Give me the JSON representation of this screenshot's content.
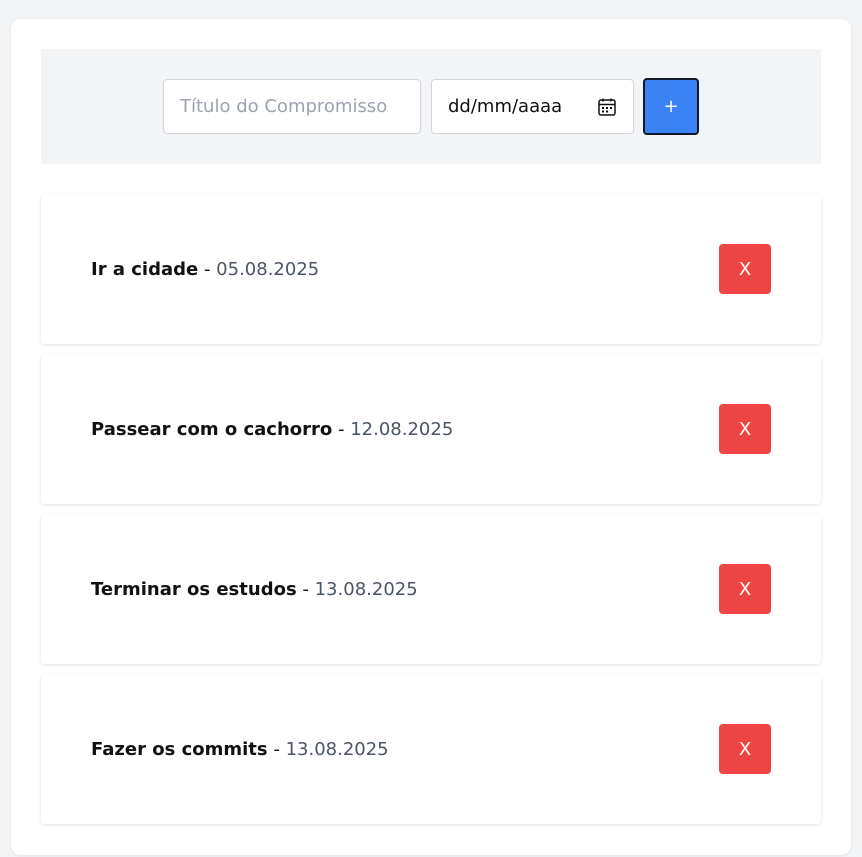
{
  "form": {
    "title_placeholder": "Título do Compromisso",
    "date_placeholder": "dd/mm/aaaa",
    "add_label": "+"
  },
  "items": [
    {
      "title": "Ir a cidade",
      "separator": " - ",
      "date": "05.08.2025",
      "delete_label": "X"
    },
    {
      "title": "Passear com o cachorro",
      "separator": " - ",
      "date": "12.08.2025",
      "delete_label": "X"
    },
    {
      "title": "Terminar os estudos",
      "separator": " - ",
      "date": "13.08.2025",
      "delete_label": "X"
    },
    {
      "title": "Fazer os commits",
      "separator": " - ",
      "date": "13.08.2025",
      "delete_label": "X"
    }
  ],
  "colors": {
    "primary": "#3b82f6",
    "danger": "#ef4444",
    "background": "#f3f4f6"
  }
}
